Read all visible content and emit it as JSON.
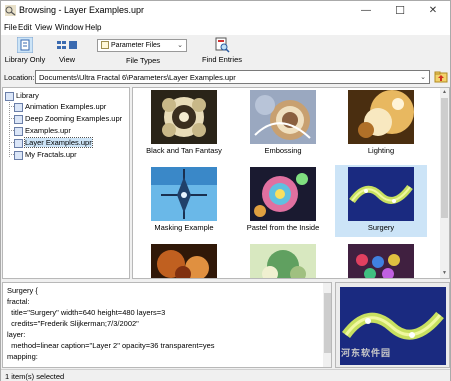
{
  "window": {
    "title": "Browsing - Layer Examples.upr",
    "minimize_glyph": "—",
    "maximize_glyph": "☐",
    "close_glyph": "✕"
  },
  "menu": [
    "File",
    "Edit",
    "View",
    "Window",
    "Help"
  ],
  "toolbar": {
    "library_only": "Library Only",
    "view": "View",
    "file_types": "File Types",
    "file_types_value": "Parameter Files",
    "find_entries": "Find Entries"
  },
  "location": {
    "label": "Location:",
    "value": "Documents\\Ultra Fractal 6\\Parameters\\Layer Examples.upr"
  },
  "tree": {
    "root": "Library",
    "items": [
      {
        "label": "Animation Examples.upr",
        "selected": false
      },
      {
        "label": "Deep Zooming Examples.upr",
        "selected": false
      },
      {
        "label": "Examples.upr",
        "selected": false
      },
      {
        "label": "Layer Examples.upr",
        "selected": true
      },
      {
        "label": "My Fractals.upr",
        "selected": false
      }
    ]
  },
  "thumbnails": [
    {
      "caption": "Black and Tan Fantasy",
      "selected": false
    },
    {
      "caption": "Embossing",
      "selected": false
    },
    {
      "caption": "Lighting",
      "selected": false
    },
    {
      "caption": "Masking Example",
      "selected": false
    },
    {
      "caption": "Pastel from the Inside",
      "selected": false
    },
    {
      "caption": "Surgery",
      "selected": true
    },
    {
      "caption": "",
      "selected": false
    },
    {
      "caption": "",
      "selected": false
    },
    {
      "caption": "",
      "selected": false
    }
  ],
  "code": [
    "Surgery {",
    "fractal:",
    "  title=\"Surgery\" width=640 height=480 layers=3",
    "  credits=\"Frederik Slijkerman;7/3/2002\"",
    "layer:",
    "  method=linear caption=\"Layer 2\" opacity=36 transparent=yes",
    "mapping:"
  ],
  "status": {
    "text": "1 item(s) selected"
  },
  "watermark": "河东软件园"
}
